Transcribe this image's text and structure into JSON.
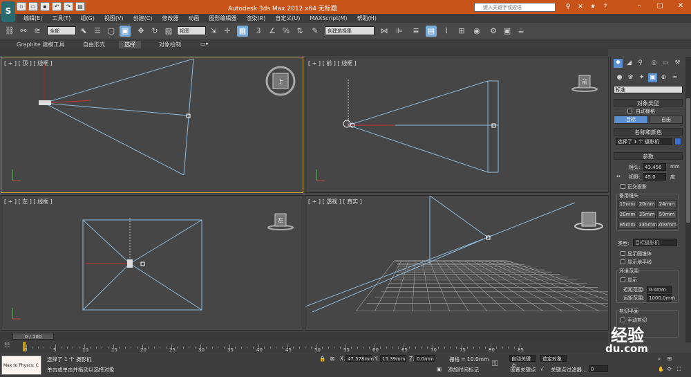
{
  "window": {
    "title": "Autodesk 3ds Max  2012 x64    无标题",
    "search_placeholder": "键入关键字或短语",
    "logo": "S"
  },
  "menu": [
    "编辑(E)",
    "工具(T)",
    "组(G)",
    "视图(V)",
    "创建(C)",
    "修改器",
    "动画",
    "图形编辑器",
    "渲染(R)",
    "自定义(U)",
    "MAXScript(M)",
    "帮助(H)"
  ],
  "toolbar": {
    "selection_filter": "全部",
    "ref_coord": "视图",
    "named_selection": "创建选择集"
  },
  "ribbon": {
    "tabs": [
      "Graphite 建模工具",
      "自由形式",
      "选择",
      "对象绘制"
    ]
  },
  "viewports": {
    "top": {
      "label": "[ + ] [ 顶 ] [ 线框 ]"
    },
    "front": {
      "label": "[ + ] [ 前 ] [ 线框 ]"
    },
    "left": {
      "label": "[ + ] [ 左 ] [ 线框 ]"
    },
    "persp": {
      "label": "[ + ] [ 透视 ] [ 真实 ]"
    },
    "cube_top": "上",
    "cube_front": "前",
    "cube_left": "左"
  },
  "command_panel": {
    "dropdown": "标准",
    "object_type": {
      "header": "对象类型",
      "autogrid": "自动栅格",
      "btn_target": "目标",
      "btn_free": "自由"
    },
    "name_color": {
      "header": "名称和颜色",
      "name_value": "选择了 1 个 摄影机"
    },
    "params": {
      "header": "参数",
      "lens_label": "镜头:",
      "lens_value": "43.456",
      "lens_unit": "mm",
      "fov_label": "视野:",
      "fov_value": "45.0",
      "fov_unit": "度",
      "ortho": "正交投影",
      "stock_lens": "备用镜头",
      "lens_buttons": [
        "15mm",
        "20mm",
        "24mm",
        "28mm",
        "35mm",
        "50mm",
        "85mm",
        "135mm",
        "200mm"
      ],
      "type_label": "类型:",
      "type_value": "目标摄影机",
      "show_cone": "显示圆锥体",
      "show_horizon": "显示地平线",
      "env_range": "环境范围",
      "show": "显示",
      "near_label": "近距范围:",
      "near_value": "0.0mm",
      "far_label": "远距范围:",
      "far_value": "1000.0mm",
      "clip_plane": "剪切平面",
      "manual_clip": "手动剪切"
    }
  },
  "timeline": {
    "frame": "0 / 100",
    "ticks": [
      "0",
      "5",
      "10",
      "15",
      "20",
      "25",
      "30",
      "35",
      "40",
      "45",
      "50",
      "55",
      "60",
      "65",
      "70",
      "75",
      "80",
      "85"
    ]
  },
  "status": {
    "maxscript": "Max to Physcs: C",
    "line1": "选择了 1 个 摄影机",
    "line2": "单击或单击并拖动以选择对象",
    "x_label": "X:",
    "x_value": "47.578mm",
    "y_label": "Y:",
    "y_value": "15.39mm",
    "z_label": "Z:",
    "z_value": "0.0mm",
    "grid": "栅格 = 10.0mm",
    "add_time_tag": "添加时间标记",
    "auto_key": "自动关键点",
    "set_key": "设置关键点",
    "key_filter": "关键点过滤器...",
    "selected": "选定对象",
    "frame_field": "0"
  },
  "watermark": {
    "big": "经验",
    "small": "du.com"
  },
  "colors": {
    "title_bg": "#c8541a",
    "viewport_bg": "#464646",
    "active_border": "#c9a64a",
    "accent_blue": "#5a8fd0",
    "camera_line": "#8fb8d8"
  }
}
